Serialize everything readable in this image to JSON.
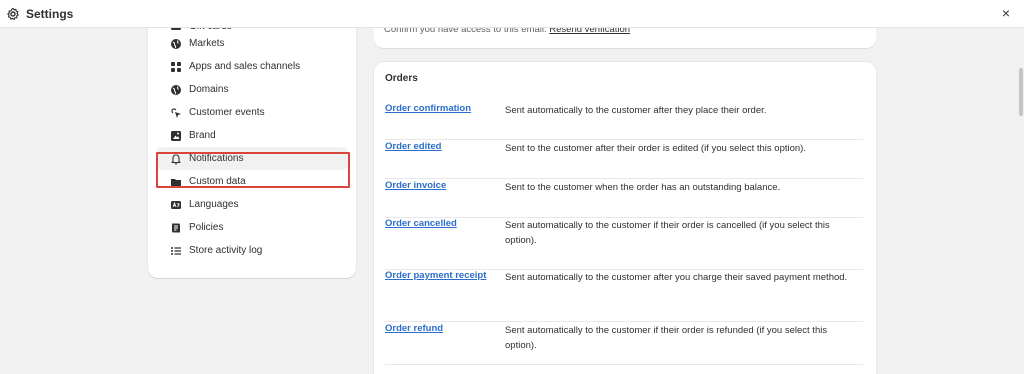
{
  "topbar": {
    "title": "Settings",
    "icon": "gear-icon",
    "close_icon": "close-icon",
    "close_glyph": "×"
  },
  "sidebar": {
    "items": [
      {
        "label": "Gift cards",
        "icon": "gift-card-icon"
      },
      {
        "label": "Markets",
        "icon": "globe-icon"
      },
      {
        "label": "Apps and sales channels",
        "icon": "apps-icon"
      },
      {
        "label": "Domains",
        "icon": "globe-icon"
      },
      {
        "label": "Customer events",
        "icon": "sparkle-icon"
      },
      {
        "label": "Brand",
        "icon": "brand-icon"
      },
      {
        "label": "Notifications",
        "icon": "bell-icon"
      },
      {
        "label": "Custom data",
        "icon": "folder-icon"
      },
      {
        "label": "Languages",
        "icon": "language-icon"
      },
      {
        "label": "Policies",
        "icon": "policy-icon"
      },
      {
        "label": "Store activity log",
        "icon": "list-icon"
      }
    ],
    "active": "Notifications"
  },
  "email_card": {
    "text": "Confirm you have access to this email.",
    "link": "Resend verification"
  },
  "orders": {
    "heading": "Orders",
    "rows": [
      {
        "name": "Order confirmation",
        "description": "Sent automatically to the customer after they place their order."
      },
      {
        "name": "Order edited",
        "description": "Sent to the customer after their order is edited (if you select this option)."
      },
      {
        "name": "Order invoice",
        "description": "Sent to the customer when the order has an outstanding balance."
      },
      {
        "name": "Order cancelled",
        "description": "Sent automatically to the customer if their order is cancelled (if you select this option)."
      },
      {
        "name": "Order payment receipt",
        "description": "Sent automatically to the customer after you charge their saved payment method."
      },
      {
        "name": "Order refund",
        "description": "Sent automatically to the customer if their order is refunded (if you select this option)."
      }
    ]
  },
  "colors": {
    "link": "#2c6ecb",
    "highlight": "#d8453b",
    "background": "#f1f1f1"
  }
}
